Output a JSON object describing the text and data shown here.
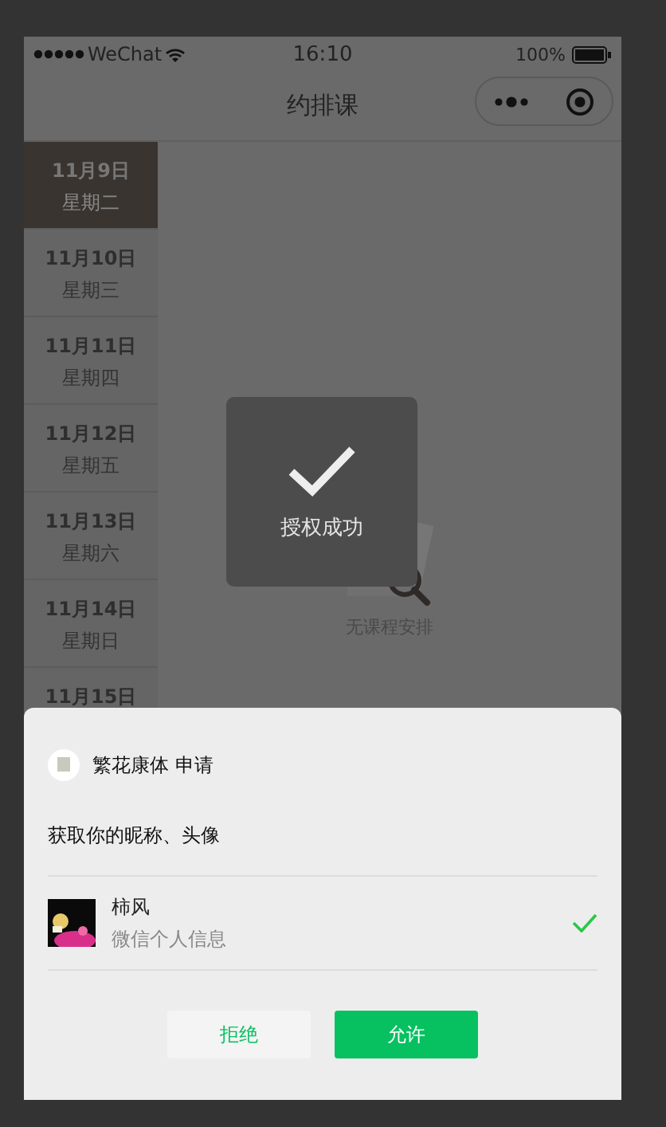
{
  "status_bar": {
    "carrier": "WeChat",
    "time": "16:10",
    "battery": "100%"
  },
  "nav": {
    "title": "约排课"
  },
  "days": [
    {
      "date": "11月9日",
      "weekday": "星期二",
      "selected": true
    },
    {
      "date": "11月10日",
      "weekday": "星期三",
      "selected": false
    },
    {
      "date": "11月11日",
      "weekday": "星期四",
      "selected": false
    },
    {
      "date": "11月12日",
      "weekday": "星期五",
      "selected": false
    },
    {
      "date": "11月13日",
      "weekday": "星期六",
      "selected": false
    },
    {
      "date": "11月14日",
      "weekday": "星期日",
      "selected": false
    },
    {
      "date": "11月15日",
      "selected": false
    }
  ],
  "empty_state": {
    "text": "无课程安排"
  },
  "toast": {
    "text": "授权成功"
  },
  "auth_sheet": {
    "app_name": "繁花康体",
    "action": "申请",
    "scope": "获取你的昵称、头像",
    "accounts": [
      {
        "name": "柿风",
        "subtitle": "微信个人信息",
        "selected": true
      }
    ],
    "buttons": [
      {
        "label": "拒绝",
        "kind": "reject"
      },
      {
        "label": "允许",
        "kind": "allow"
      }
    ]
  }
}
